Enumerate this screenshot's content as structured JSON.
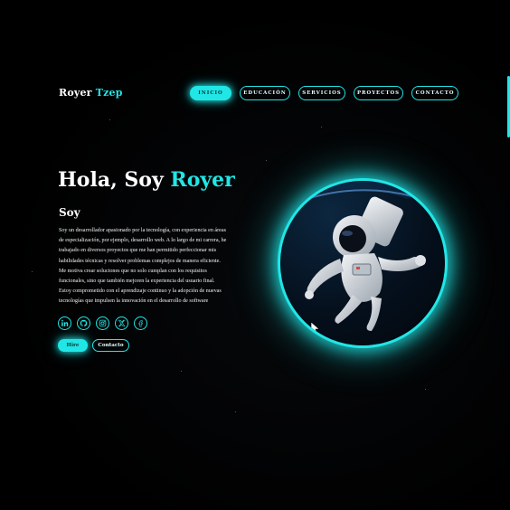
{
  "logo": {
    "first": "Royer",
    "accent": "Tzep"
  },
  "nav": {
    "items": [
      {
        "label": "INICIO",
        "active": true
      },
      {
        "label": "EDUCACIÓN",
        "active": false
      },
      {
        "label": "SERVICIOS",
        "active": false
      },
      {
        "label": "PROYECTOS",
        "active": false
      },
      {
        "label": "CONTACTO",
        "active": false
      }
    ]
  },
  "hero": {
    "greeting": "Hola, Soy",
    "name": "Royer",
    "subtitle": "Soy",
    "description_lines": [
      "Soy un desarrollador apasionado por la tecnología, con experiencia en áreas",
      "de especialización, por ejemplo, desarrollo web. A lo largo de mi carrera, he",
      "trabajado en diversos proyectos que me han permitido perfeccionar mis",
      "habilidades técnicas y resolver problemas complejos de manera eficiente.",
      "Me motiva crear soluciones que no solo cumplan con los requisitos",
      "funcionales, sino que también mejoren la experiencia del usuario final.",
      "Estoy comprometido con el aprendizaje continuo y la adopción de nuevas",
      "tecnologías que impulsen la innovación en el desarrollo de software"
    ],
    "socials": [
      {
        "icon": "linkedin-icon"
      },
      {
        "icon": "github-icon"
      },
      {
        "icon": "instagram-icon"
      },
      {
        "icon": "x-twitter-icon"
      },
      {
        "icon": "facebook-icon"
      }
    ],
    "buttons": {
      "primary": "Hire",
      "secondary": "Contacto"
    },
    "image": "astronaut-floating-in-space"
  },
  "colors": {
    "accent": "#21e6e6",
    "background": "#000000",
    "text": "#ffffff"
  }
}
